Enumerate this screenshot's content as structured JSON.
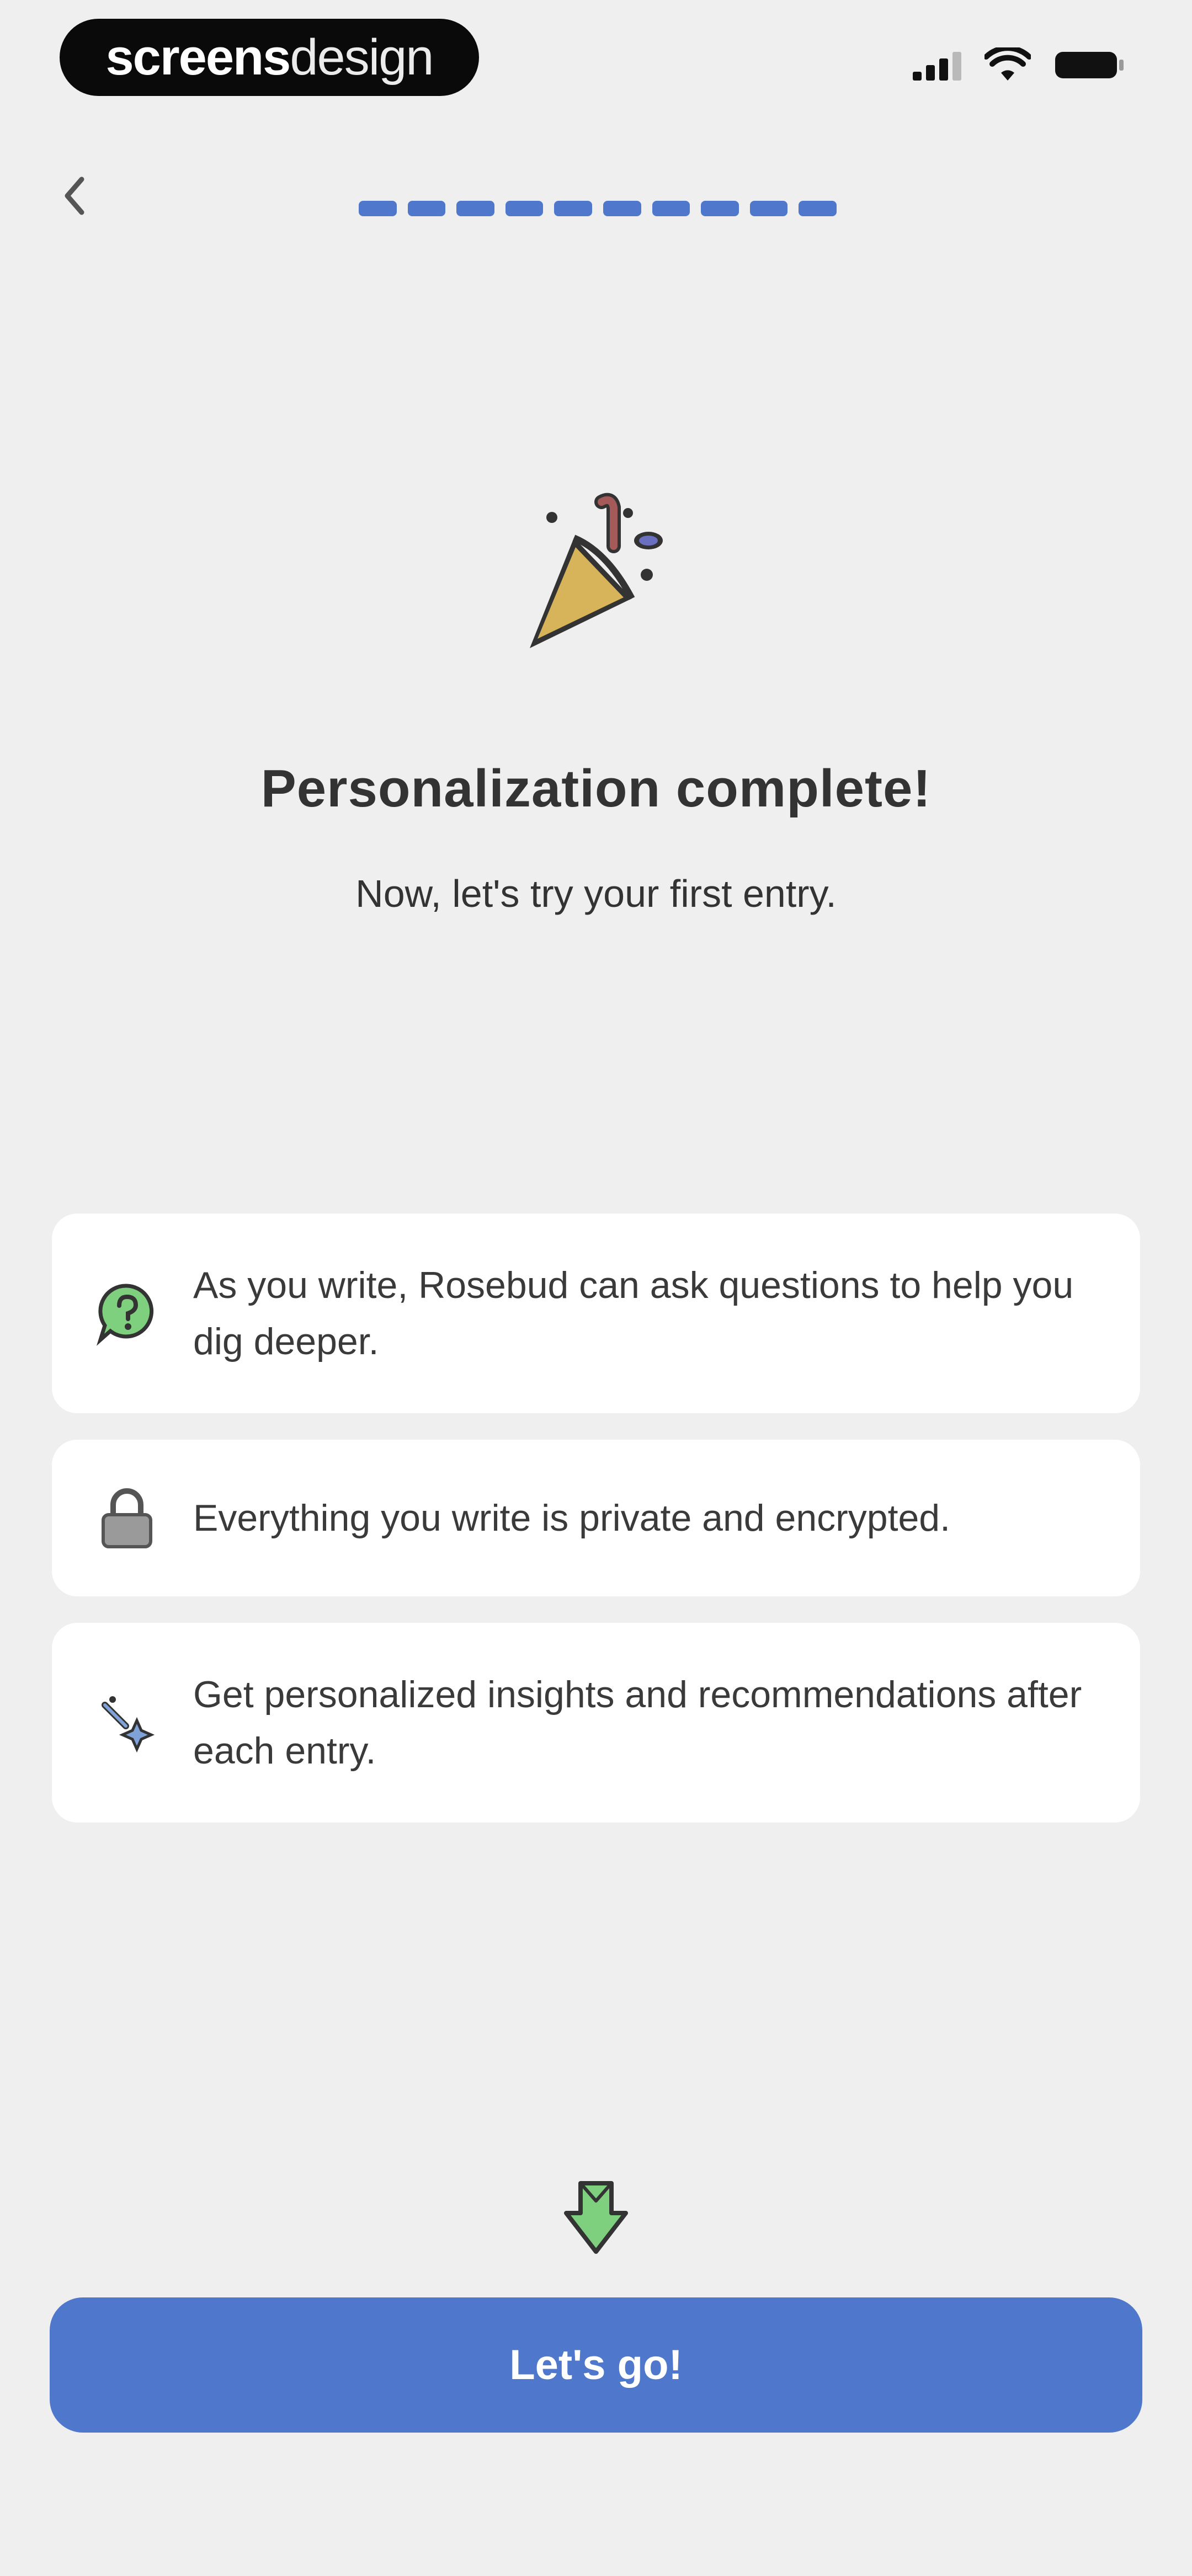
{
  "status_bar": {
    "brand_bold": "screens",
    "brand_light": "design"
  },
  "header": {
    "progress_segments": 10,
    "progress_color": "#4f77cc"
  },
  "hero": {
    "icon": "party-popper-icon",
    "title": "Personalization complete!",
    "subtitle": "Now, let's try your first entry."
  },
  "features": [
    {
      "icon": "chat-question-icon",
      "text": "As you write, Rosebud can ask questions to help you dig deeper."
    },
    {
      "icon": "lock-icon",
      "text": "Everything you write is private and encrypted."
    },
    {
      "icon": "sparkle-wand-icon",
      "text": "Get personalized insights and recommendations after each entry."
    }
  ],
  "cta": {
    "label": "Let's go!",
    "color": "#4f78cd"
  },
  "colors": {
    "background": "#efefef",
    "card": "#ffffff",
    "text": "#333333",
    "accent_green": "#7ed07e"
  }
}
